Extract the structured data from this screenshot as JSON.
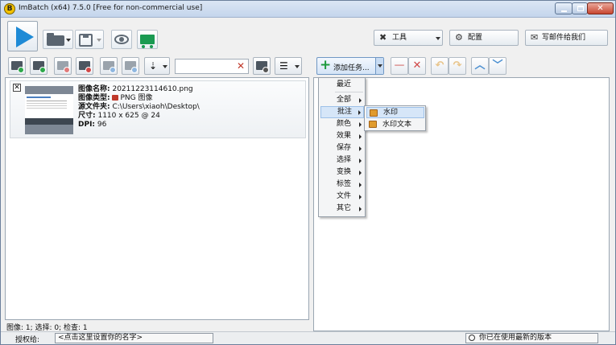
{
  "window": {
    "title": "ImBatch (x64) 7.5.0 [Free for non-commercial use]",
    "app_icon_letter": "B"
  },
  "toolbar_right": {
    "tools_label": "工具",
    "settings_label": "配置",
    "email_label": "写邮件给我们"
  },
  "image_list": {
    "items": [
      {
        "name_label": "图像名称:",
        "name_value": "20211223114610.png",
        "type_label": "图像类型:",
        "type_value": "PNG 图像",
        "folder_label": "源文件夹:",
        "folder_value": "C:\\Users\\xiaoh\\Desktop\\",
        "size_label": "尺寸:",
        "size_value": "1110 x 625 @ 24",
        "dpi_label": "DPI:",
        "dpi_value": "96"
      }
    ]
  },
  "task_toolbar": {
    "add_task_label": "添加任务..."
  },
  "task_menu": {
    "items": [
      {
        "label": "最近",
        "has_submenu": false
      },
      {
        "label": "全部",
        "has_submenu": true
      },
      {
        "label": "批注",
        "has_submenu": true,
        "highlighted": true
      },
      {
        "label": "颜色",
        "has_submenu": true
      },
      {
        "label": "效果",
        "has_submenu": true
      },
      {
        "label": "保存",
        "has_submenu": true
      },
      {
        "label": "选择",
        "has_submenu": true
      },
      {
        "label": "变换",
        "has_submenu": true
      },
      {
        "label": "标签",
        "has_submenu": true
      },
      {
        "label": "文件",
        "has_submenu": true
      },
      {
        "label": "其它",
        "has_submenu": true
      }
    ],
    "submenu": [
      {
        "label": "水印",
        "highlighted": true
      },
      {
        "label": "水印文本",
        "highlighted": false
      }
    ]
  },
  "status": {
    "counts": "图像: 1; 选择: 0; 检查: 1",
    "license_label": "授权给:",
    "license_value": "<点击这里设置你的名字>",
    "version_text": "你已在使用最新的版本"
  },
  "colors": {
    "play": "#1e8ad6",
    "add_task_plus": "#1d9a3c",
    "remove_red": "#d04848",
    "move_blue": "#4b8fd1",
    "undo_orange": "#e59a3b",
    "highlight": "#d6e6f8"
  },
  "icons": {
    "play": "play-icon",
    "open": "folder-icon",
    "save": "save-icon",
    "preview": "eye-icon",
    "buy": "cart-icon",
    "tools": "wrench-icon",
    "settings": "gear-icon",
    "email": "envelope-icon"
  }
}
